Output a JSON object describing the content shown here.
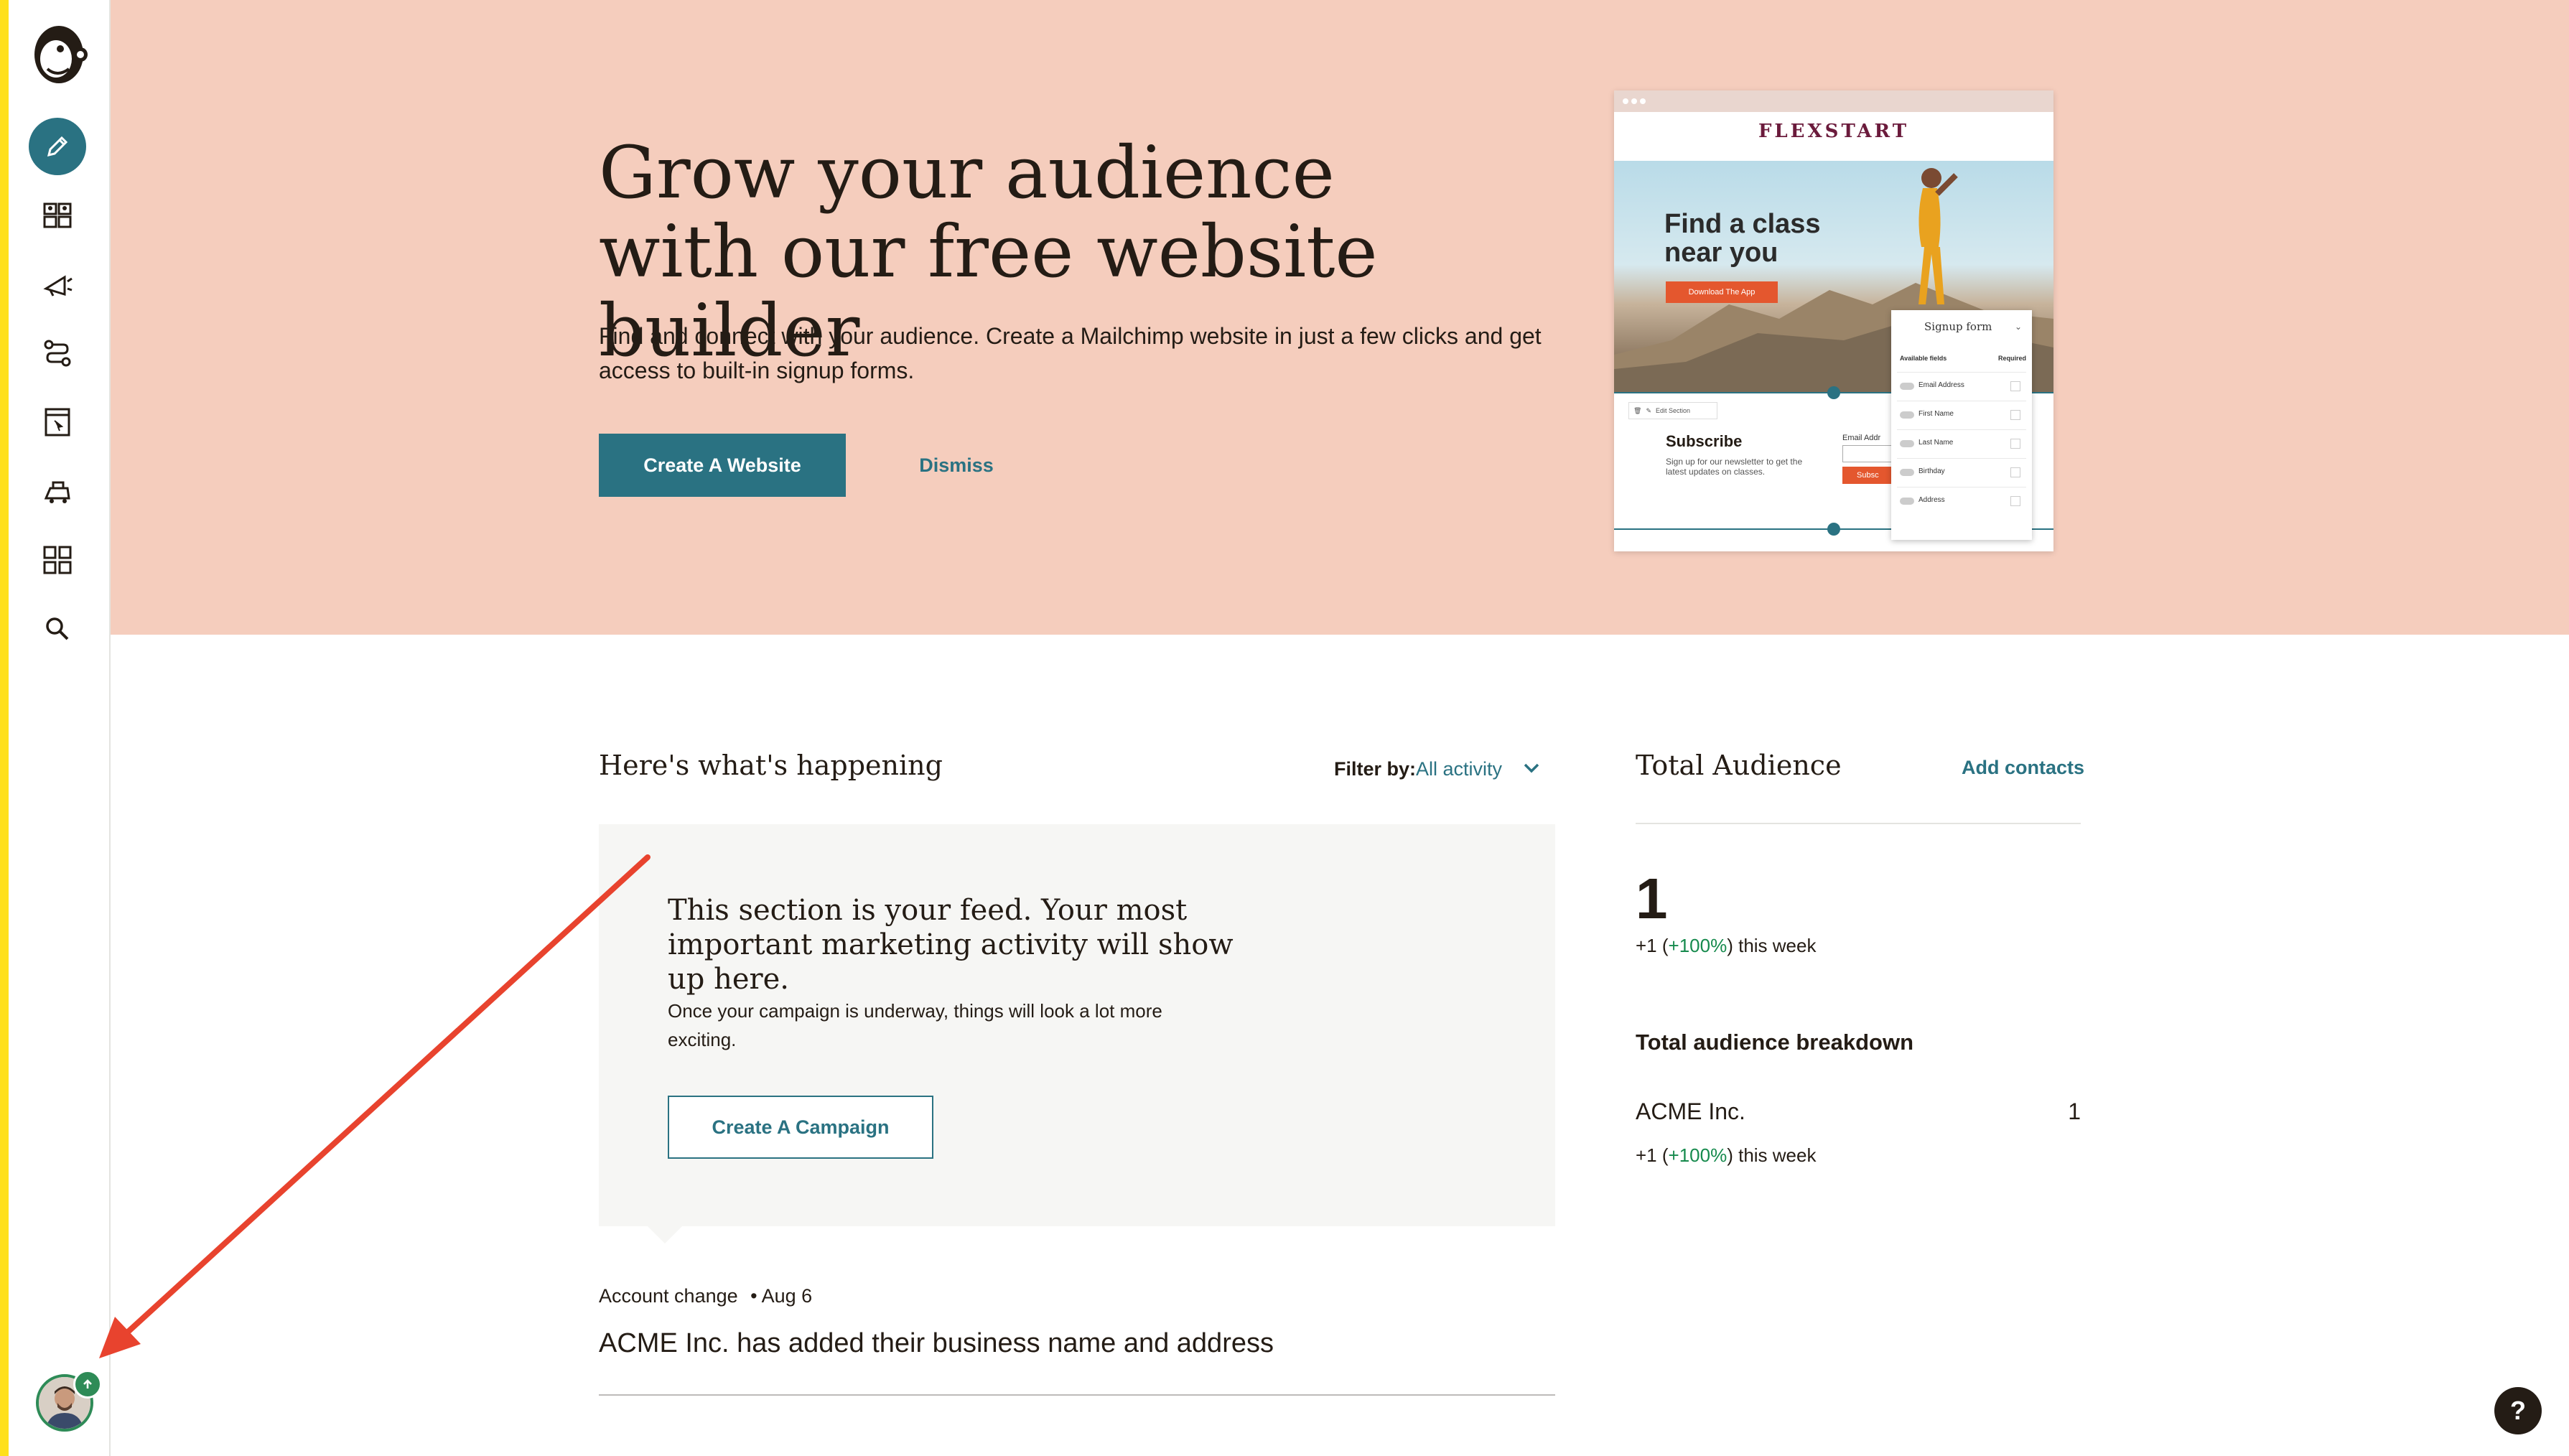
{
  "sidebar": {
    "items": [
      {
        "name": "create",
        "icon": "pencil-icon"
      },
      {
        "name": "audience",
        "icon": "audience-icon"
      },
      {
        "name": "campaigns",
        "icon": "megaphone-icon"
      },
      {
        "name": "automations",
        "icon": "automations-icon"
      },
      {
        "name": "website",
        "icon": "website-icon"
      },
      {
        "name": "content-studio",
        "icon": "content-studio-icon"
      },
      {
        "name": "integrations",
        "icon": "integrations-icon"
      },
      {
        "name": "search",
        "icon": "search-icon"
      }
    ]
  },
  "hero": {
    "title": "Grow your audience with our free website builder",
    "description": "Find and connect with your audience. Create a Mailchimp website in just a few clicks and get access to built-in signup forms.",
    "primary_button": "Create A Website",
    "dismiss": "Dismiss",
    "preview": {
      "brand": "FLEXSTART",
      "headline": "Find a class near you",
      "download_button": "Download The App",
      "edit_section": "Edit Section",
      "subscribe_title": "Subscribe",
      "subscribe_desc": "Sign up for our newsletter to get the latest updates on classes.",
      "email_label": "Email Addr",
      "submit": "Subsc",
      "signup_form": {
        "title": "Signup form",
        "col_fields": "Available fields",
        "col_required": "Required",
        "fields": [
          "Email Address",
          "First Name",
          "Last Name",
          "Birthday",
          "Address"
        ]
      }
    }
  },
  "feed": {
    "heading": "Here's what's happening",
    "filter_label": "Filter by:",
    "filter_value": "All activity",
    "empty_title": "This section is your feed. Your most important marketing activity will show up here.",
    "empty_desc": "Once your campaign is underway, things will look a lot more exciting.",
    "button": "Create A Campaign",
    "items": [
      {
        "type": "Account change",
        "date": "• Aug 6",
        "text": "ACME Inc. has added their business name and address"
      }
    ]
  },
  "audience": {
    "title": "Total Audience",
    "add_link": "Add contacts",
    "count": "1",
    "week_prefix": "+1 (",
    "week_pct": "+100%",
    "week_suffix": ") this week",
    "breakdown_title": "Total audience breakdown",
    "breakdown": [
      {
        "name": "ACME Inc.",
        "value": "1",
        "week_prefix": "+1 (",
        "week_pct": "+100%",
        "week_suffix": ") this week"
      }
    ]
  },
  "help": {
    "label": "?"
  },
  "colors": {
    "accent": "#2a7282",
    "hero_bg": "#f5cdbd",
    "positive": "#168a4d",
    "brand_yellow": "#ffe01b"
  }
}
